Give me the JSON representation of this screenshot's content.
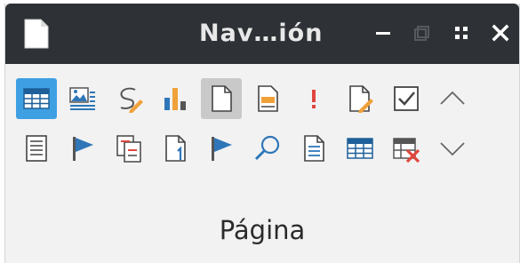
{
  "window": {
    "title": "Nav…ión",
    "controls": [
      "minimize",
      "restore",
      "menu",
      "close"
    ]
  },
  "toolbar": {
    "row1": [
      {
        "name": "table-icon",
        "state": "active"
      },
      {
        "name": "image-text-icon"
      },
      {
        "name": "link-pencil-icon"
      },
      {
        "name": "bar-chart-icon"
      },
      {
        "name": "page-icon",
        "state": "pressed"
      },
      {
        "name": "document-orange-icon"
      },
      {
        "name": "exclamation-icon"
      },
      {
        "name": "edit-document-icon"
      },
      {
        "name": "checkbox-icon"
      },
      {
        "name": "chevron-up-icon"
      }
    ],
    "row2": [
      {
        "name": "text-frame-icon"
      },
      {
        "name": "flag-icon"
      },
      {
        "name": "document-compare-icon"
      },
      {
        "name": "page-number-icon"
      },
      {
        "name": "flag-icon-2"
      },
      {
        "name": "search-icon"
      },
      {
        "name": "document-lines-icon"
      },
      {
        "name": "table-2-icon"
      },
      {
        "name": "delete-table-icon"
      },
      {
        "name": "chevron-down-icon"
      }
    ]
  },
  "panel": {
    "label": "Página"
  },
  "colors": {
    "titlebar": "#2e3236",
    "accent": "#3ea0e3",
    "pressed": "#c9c9c9",
    "orange": "#f0a13a",
    "red": "#e0473d",
    "blue": "#2f76b8"
  }
}
